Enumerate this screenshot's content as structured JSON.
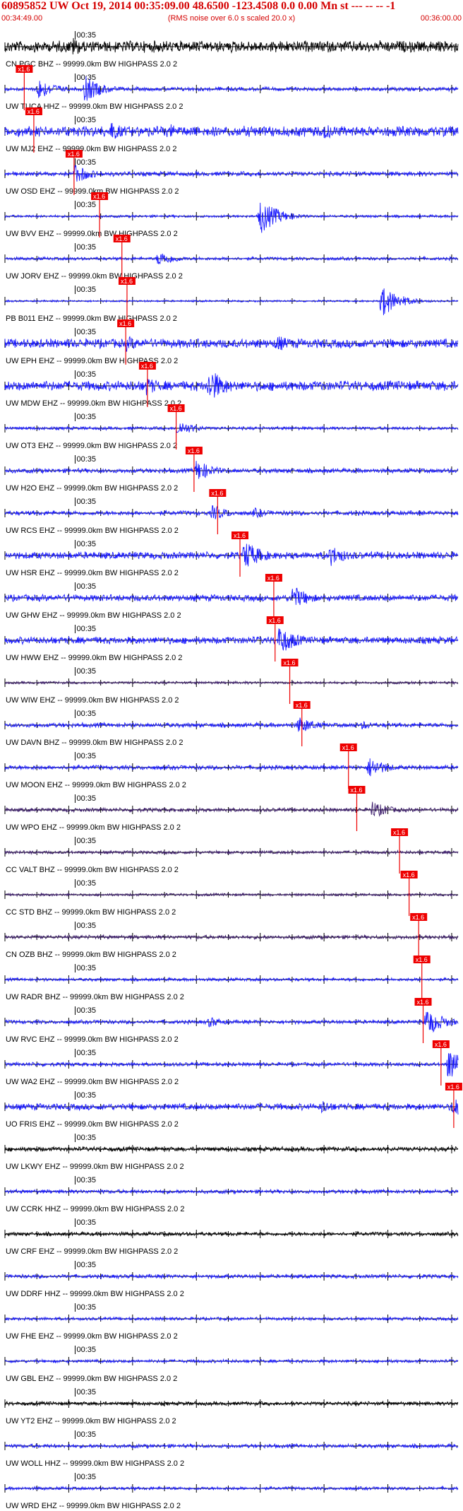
{
  "header": {
    "title": "60895852 UW Oct 19, 2014 00:35:09.00   48.6500 -123.4508  0.0 0.00 Mn st --- -- --  -1",
    "start_time": "00:34:49.00",
    "note": "(RMS noise over 6.0 s scaled 20.0 x)",
    "end_time": "00:36:00.00"
  },
  "colors": {
    "header_text": "#d40000",
    "pick_box": "#ee0000",
    "pick_line": "#ee0000",
    "trace_blue": "#1a1aff",
    "trace_black": "#000000",
    "trace_purple": "#3a1a6a"
  },
  "chart_data": {
    "type": "line",
    "title": "60895852 UW Oct 19, 2014 00:35:09.00   48.6500 -123.4508  0.0 0.00 Mn st --- -- --  -1",
    "x_axis": {
      "start": "00:34:49.00",
      "end": "00:36:00.00",
      "duration_s": 71,
      "tick_label": "00:35",
      "tick_label_time_s": 11
    },
    "pick_label": "x1.6",
    "traces": [
      {
        "label": "CN PGC BHZ -- 99999.0km BW  HIGHPASS  2.0  2",
        "color": "black",
        "pick_s": null,
        "amplitude": 0.35,
        "events": [
          {
            "t": 10.5,
            "amp": 0.55
          },
          {
            "t": 24.5,
            "amp": 0.35
          }
        ]
      },
      {
        "label": "UW TUCA HHZ -- 99999.0km BW  HIGHPASS  2.0  2",
        "color": "blue",
        "pick_s": 1.7,
        "amplitude": 0.12,
        "events": [
          {
            "t": 5.2,
            "amp": 0.6
          },
          {
            "t": 12.5,
            "amp": 0.75
          }
        ]
      },
      {
        "label": "UW MJ2 EHZ -- 99999.0km BW  HIGHPASS  2.0  2",
        "color": "blue",
        "pick_s": 3.2,
        "amplitude": 0.32,
        "events": [
          {
            "t": 16.5,
            "amp": 0.55
          },
          {
            "t": 26,
            "amp": 0.4
          },
          {
            "t": 50,
            "amp": 0.45
          }
        ]
      },
      {
        "label": "UW OSD EHZ -- 99999.0km BW  HIGHPASS  2.0  2",
        "color": "blue",
        "pick_s": 9.5,
        "amplitude": 0.14,
        "events": [
          {
            "t": 11,
            "amp": 0.55
          }
        ]
      },
      {
        "label": "UW BVV EHZ -- 99999.0km BW  HIGHPASS  2.0  2",
        "color": "blue",
        "pick_s": 13.5,
        "amplitude": 0.08,
        "events": [
          {
            "t": 40,
            "amp": 1.0
          }
        ]
      },
      {
        "label": "UW JORV EHZ -- 99999.0km BW  HIGHPASS  2.0  2",
        "color": "blue",
        "pick_s": 17.0,
        "amplitude": 0.1,
        "events": [
          {
            "t": 24,
            "amp": 0.45
          }
        ]
      },
      {
        "label": "PB B011 EHZ -- 99999.0km BW  HIGHPASS  2.0  2",
        "color": "blue",
        "pick_s": 17.8,
        "amplitude": 0.06,
        "events": [
          {
            "t": 59,
            "amp": 0.9
          }
        ]
      },
      {
        "label": "UW EPH EHZ -- 99999.0km BW  HIGHPASS  2.0  2",
        "color": "blue",
        "pick_s": 17.6,
        "amplitude": 0.28,
        "events": [
          {
            "t": 19,
            "amp": 0.45
          },
          {
            "t": 42.5,
            "amp": 0.5
          }
        ]
      },
      {
        "label": "UW MDW EHZ -- 99999.0km BW  HIGHPASS  2.0  2",
        "color": "blue",
        "pick_s": 21.0,
        "amplitude": 0.3,
        "events": [
          {
            "t": 22,
            "amp": 0.55
          },
          {
            "t": 32,
            "amp": 1.0
          }
        ]
      },
      {
        "label": "UW OT3 EHZ -- 99999.0km BW  HIGHPASS  2.0  2",
        "color": "blue",
        "pick_s": 25.5,
        "amplitude": 0.1,
        "events": [
          {
            "t": 27,
            "amp": 0.45
          }
        ]
      },
      {
        "label": "UW H2O EHZ -- 99999.0km BW  HIGHPASS  2.0  2",
        "color": "blue",
        "pick_s": 28.3,
        "amplitude": 0.14,
        "events": [
          {
            "t": 30,
            "amp": 0.6
          }
        ]
      },
      {
        "label": "UW RCS EHZ -- 99999.0km BW  HIGHPASS  2.0  2",
        "color": "blue",
        "pick_s": 32.0,
        "amplitude": 0.14,
        "events": [
          {
            "t": 32.5,
            "amp": 0.45
          },
          {
            "t": 39,
            "amp": 0.3
          }
        ]
      },
      {
        "label": "UW HSR EHZ -- 99999.0km BW  HIGHPASS  2.0  2",
        "color": "blue",
        "pick_s": 35.5,
        "amplitude": 0.22,
        "events": [
          {
            "t": 37.5,
            "amp": 0.85
          },
          {
            "t": 51,
            "amp": 0.6
          }
        ]
      },
      {
        "label": "UW GHW EHZ -- 99999.0km BW  HIGHPASS  2.0  2",
        "color": "blue",
        "pick_s": 40.8,
        "amplitude": 0.2,
        "events": [
          {
            "t": 45,
            "amp": 0.7
          }
        ]
      },
      {
        "label": "UW HWW EHZ -- 99999.0km BW  HIGHPASS  2.0  2",
        "color": "blue",
        "pick_s": 41.0,
        "amplitude": 0.22,
        "events": [
          {
            "t": 43,
            "amp": 0.85
          }
        ]
      },
      {
        "label": "UW WIW EHZ -- 99999.0km BW  HIGHPASS  2.0  2",
        "color": "purple",
        "pick_s": 43.3,
        "amplitude": 0.08,
        "events": []
      },
      {
        "label": "UW DAVN BHZ -- 99999.0km BW  HIGHPASS  2.0  2",
        "color": "blue",
        "pick_s": 45.2,
        "amplitude": 0.14,
        "events": [
          {
            "t": 46,
            "amp": 0.5
          },
          {
            "t": 56,
            "amp": 0.25
          }
        ]
      },
      {
        "label": "UW MOON EHZ -- 99999.0km BW  HIGHPASS  2.0  2",
        "color": "blue",
        "pick_s": 52.5,
        "amplitude": 0.14,
        "events": [
          {
            "t": 57,
            "amp": 0.6
          }
        ]
      },
      {
        "label": "UW WPO EHZ -- 99999.0km BW  HIGHPASS  2.0  2",
        "color": "purple",
        "pick_s": 53.8,
        "amplitude": 0.12,
        "events": [
          {
            "t": 57.5,
            "amp": 0.5
          }
        ]
      },
      {
        "label": "CC VALT BHZ -- 99999.0km BW  HIGHPASS  2.0  2",
        "color": "purple",
        "pick_s": 60.5,
        "amplitude": 0.1,
        "events": []
      },
      {
        "label": "CC STD BHZ -- 99999.0km BW  HIGHPASS  2.0  2",
        "color": "purple",
        "pick_s": 62.0,
        "amplitude": 0.08,
        "events": []
      },
      {
        "label": "CN OZB BHZ -- 99999.0km BW  HIGHPASS  2.0  2",
        "color": "purple",
        "pick_s": 63.5,
        "amplitude": 0.12,
        "events": []
      },
      {
        "label": "UW RADR BHZ -- 99999.0km BW  HIGHPASS  2.0  2",
        "color": "blue",
        "pick_s": 64.0,
        "amplitude": 0.1,
        "events": []
      },
      {
        "label": "UW RVC EHZ -- 99999.0km BW  HIGHPASS  2.0  2",
        "color": "blue",
        "pick_s": 64.2,
        "amplitude": 0.12,
        "events": [
          {
            "t": 32,
            "amp": 0.3
          },
          {
            "t": 66,
            "amp": 0.8
          }
        ]
      },
      {
        "label": "UW WA2 EHZ -- 99999.0km BW  HIGHPASS  2.0  2",
        "color": "blue",
        "pick_s": 67.0,
        "amplitude": 0.12,
        "events": [
          {
            "t": 69.5,
            "amp": 1.0
          }
        ]
      },
      {
        "label": "UO FRIS EHZ -- 99999.0km BW  HIGHPASS  2.0  2",
        "color": "blue",
        "pick_s": 69.0,
        "amplitude": 0.2,
        "events": [
          {
            "t": 49.5,
            "amp": 0.4
          },
          {
            "t": 70.3,
            "amp": 0.6
          }
        ]
      },
      {
        "label": "UW LKWY EHZ -- 99999.0km BW  HIGHPASS  2.0  2",
        "color": "black",
        "pick_s": null,
        "amplitude": 0.14,
        "events": []
      },
      {
        "label": "UW CCRK HHZ -- 99999.0km BW  HIGHPASS  2.0  2",
        "color": "blue",
        "pick_s": null,
        "amplitude": 0.12,
        "events": []
      },
      {
        "label": "UW CRF EHZ -- 99999.0km BW  HIGHPASS  2.0  2",
        "color": "black",
        "pick_s": null,
        "amplitude": 0.12,
        "events": []
      },
      {
        "label": "UW DDRF HHZ -- 99999.0km BW  HIGHPASS  2.0  2",
        "color": "blue",
        "pick_s": null,
        "amplitude": 0.12,
        "events": []
      },
      {
        "label": "UW FHE EHZ -- 99999.0km BW  HIGHPASS  2.0  2",
        "color": "blue",
        "pick_s": null,
        "amplitude": 0.1,
        "events": []
      },
      {
        "label": "UW GBL EHZ -- 99999.0km BW  HIGHPASS  2.0  2",
        "color": "blue",
        "pick_s": null,
        "amplitude": 0.1,
        "events": []
      },
      {
        "label": "UW YT2 EHZ -- 99999.0km BW  HIGHPASS  2.0  2",
        "color": "black",
        "pick_s": null,
        "amplitude": 0.12,
        "events": []
      },
      {
        "label": "UW WOLL HHZ -- 99999.0km BW  HIGHPASS  2.0  2",
        "color": "blue",
        "pick_s": null,
        "amplitude": 0.12,
        "events": []
      },
      {
        "label": "UW WRD EHZ -- 99999.0km BW  HIGHPASS  2.0  2",
        "color": "blue",
        "pick_s": null,
        "amplitude": 0.1,
        "events": []
      }
    ]
  }
}
